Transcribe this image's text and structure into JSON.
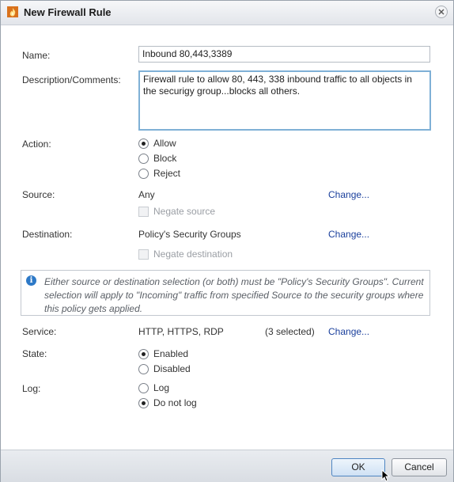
{
  "dialog": {
    "title": "New Firewall Rule",
    "icon": "firewall-icon",
    "close_icon": "close-icon"
  },
  "form": {
    "name_label": "Name:",
    "name_value": "Inbound 80,443,3389",
    "description_label": "Description/Comments:",
    "description_value": "Firewall rule to allow 80, 443, 338 inbound traffic to all objects in the securigy group...blocks all others.",
    "action_label": "Action:",
    "action_options": [
      {
        "label": "Allow",
        "checked": true
      },
      {
        "label": "Block",
        "checked": false
      },
      {
        "label": "Reject",
        "checked": false
      }
    ],
    "source_label": "Source:",
    "source_value": "Any",
    "source_change": "Change...",
    "negate_source_label": "Negate source",
    "destination_label": "Destination:",
    "destination_value": "Policy's Security Groups",
    "destination_change": "Change...",
    "negate_destination_label": "Negate destination",
    "info_text": "Either source or destination selection (or both) must be \"Policy's Security Groups\". Current selection will apply to \"Incoming\" traffic from specified Source to the security groups where this policy gets applied.",
    "service_label": "Service:",
    "service_value": "HTTP, HTTPS, RDP",
    "service_count": "(3 selected)",
    "service_change": "Change...",
    "state_label": "State:",
    "state_options": [
      {
        "label": "Enabled",
        "checked": true
      },
      {
        "label": "Disabled",
        "checked": false
      }
    ],
    "log_label": "Log:",
    "log_options": [
      {
        "label": "Log",
        "checked": false
      },
      {
        "label": "Do not log",
        "checked": true
      }
    ]
  },
  "footer": {
    "ok_label": "OK",
    "cancel_label": "Cancel"
  },
  "colors": {
    "link": "#1a3f9c",
    "focus_border": "#7fb0d6",
    "info_icon": "#2d79c7"
  }
}
